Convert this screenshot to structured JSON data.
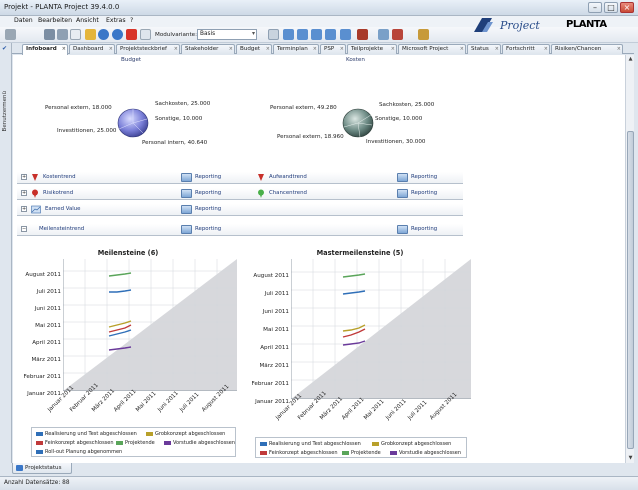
{
  "window": {
    "title": "Projekt - PLANTA Project 39.4.0.0"
  },
  "menu": [
    "Daten",
    "Bearbeiten",
    "Ansicht",
    "Extras",
    "?"
  ],
  "toolbar": {
    "variant_label": "Modulvariante:",
    "variant_value": "Basis"
  },
  "logo": {
    "project": "Project",
    "planta": "PLANTA"
  },
  "tabs": [
    {
      "label": "Infoboard",
      "active": true
    },
    {
      "label": "Dashboard"
    },
    {
      "label": "Projektsteckbrief"
    },
    {
      "label": "Stakeholder"
    },
    {
      "label": "Budget"
    },
    {
      "label": "Terminplan"
    },
    {
      "label": "PSP"
    },
    {
      "label": "Teilprojekte"
    },
    {
      "label": "Microsoft Project"
    },
    {
      "label": "Status"
    },
    {
      "label": "Fortschritt"
    },
    {
      "label": "Risiken/Chancen"
    }
  ],
  "side_panel": {
    "label": "Benutzermenü"
  },
  "budget": {
    "title": "Budget",
    "labels": [
      "Personal extern, 18.000",
      "Sachkosten, 25.000",
      "Sonstige, 10.000",
      "Investitionen, 25.000",
      "Personal intern, 40.640"
    ],
    "slices": [
      18000,
      25000,
      10000,
      25000,
      40640
    ],
    "color": "#7a7fd8"
  },
  "kosten": {
    "title": "Kosten",
    "labels": [
      "Personal extern, 49.280",
      "Sachkosten, 25.000",
      "Sonstige, 10.000",
      "Personal extern, 18.960",
      "Investitionen, 30.000"
    ],
    "slices": [
      49280,
      25000,
      10000,
      18960,
      30000
    ],
    "color": "#6c8a84"
  },
  "trends": {
    "kostentrend": "Kostentrend",
    "aufwandtrend": "Aufwandtrend",
    "risikotrend": "Risikotrend",
    "chancentrend": "Chancentrend",
    "earned_value": "Earned Value",
    "meilensteintrend": "Meilensteintrend",
    "reporting": "Reporting"
  },
  "charts": {
    "meilensteine_title": "Meilensteine (6)",
    "mastermeilensteine_title": "Mastermeilensteine (5)",
    "y_labels": [
      "August 2011",
      "Juli 2011",
      "Juni 2011",
      "Mai 2011",
      "April 2011",
      "März 2011",
      "Februar 2011",
      "Januar 2011"
    ],
    "x_labels": [
      "Januar 2011",
      "Februar 2011",
      "März 2011",
      "April 2011",
      "Mai 2011",
      "Juni 2011",
      "Juli 2011",
      "August 2011"
    ]
  },
  "legend1": [
    "Realisierung und Test abgeschlossen",
    "Grobkonzept abgeschlossen",
    "Feinkonzept abgeschlossen",
    "Projektende",
    "Vorstudie abgeschlossen",
    "Roll-out Planung abgenommen"
  ],
  "legend2": [
    "Realisierung und Test abgeschlossen",
    "Grobkonzept abgeschlossen",
    "Feinkonzept abgeschlossen",
    "Projektende",
    "Vorstudie abgeschlossen"
  ],
  "legend_colors": [
    "#2f6fb8",
    "#b8a02a",
    "#c03a3a",
    "#5aa55a",
    "#6a3a9a",
    "#2f6fb8"
  ],
  "bottom_tab": "Projektstatus",
  "status": "Anzahl Datensätze: 88"
}
